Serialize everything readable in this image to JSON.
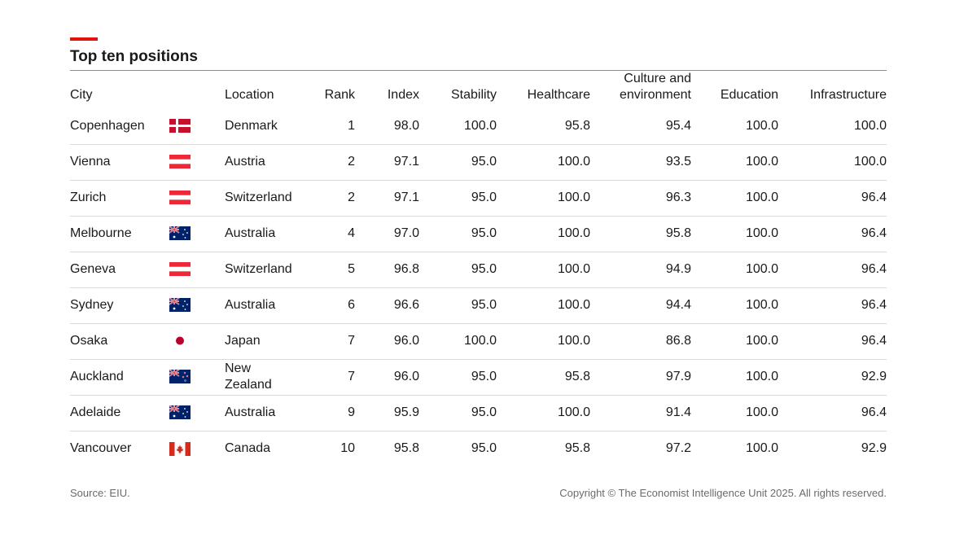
{
  "title": "Top ten positions",
  "colors": {
    "accent": "#e3120b",
    "rule": "#d9d9d9"
  },
  "chart_data": {
    "type": "table",
    "title": "Top ten positions",
    "columns": [
      "City",
      "",
      "Location",
      "Rank",
      "Index",
      "Stability",
      "Healthcare",
      "Culture and environment",
      "Education",
      "Infrastructure"
    ],
    "rows": [
      {
        "city": "Copenhagen",
        "flag": "denmark-flag-icon",
        "location": "Denmark",
        "rank": "1",
        "index": "98.0",
        "stability": "100.0",
        "healthcare": "95.8",
        "culture": "95.4",
        "education": "100.0",
        "infrastructure": "100.0"
      },
      {
        "city": "Vienna",
        "flag": "austria-flag-icon",
        "location": "Austria",
        "rank": "2",
        "index": "97.1",
        "stability": "95.0",
        "healthcare": "100.0",
        "culture": "93.5",
        "education": "100.0",
        "infrastructure": "100.0"
      },
      {
        "city": "Zurich",
        "flag": "switzerland-flag-icon",
        "location": "Switzerland",
        "rank": "2",
        "index": "97.1",
        "stability": "95.0",
        "healthcare": "100.0",
        "culture": "96.3",
        "education": "100.0",
        "infrastructure": "96.4"
      },
      {
        "city": "Melbourne",
        "flag": "australia-flag-icon",
        "location": "Australia",
        "rank": "4",
        "index": "97.0",
        "stability": "95.0",
        "healthcare": "100.0",
        "culture": "95.8",
        "education": "100.0",
        "infrastructure": "96.4"
      },
      {
        "city": "Geneva",
        "flag": "switzerland-flag-icon",
        "location": "Switzerland",
        "rank": "5",
        "index": "96.8",
        "stability": "95.0",
        "healthcare": "100.0",
        "culture": "94.9",
        "education": "100.0",
        "infrastructure": "96.4"
      },
      {
        "city": "Sydney",
        "flag": "australia-flag-icon",
        "location": "Australia",
        "rank": "6",
        "index": "96.6",
        "stability": "95.0",
        "healthcare": "100.0",
        "culture": "94.4",
        "education": "100.0",
        "infrastructure": "96.4"
      },
      {
        "city": "Osaka",
        "flag": "japan-flag-icon",
        "location": "Japan",
        "rank": "7",
        "index": "96.0",
        "stability": "100.0",
        "healthcare": "100.0",
        "culture": "86.8",
        "education": "100.0",
        "infrastructure": "96.4"
      },
      {
        "city": "Auckland",
        "flag": "new-zealand-flag-icon",
        "location": "New Zealand",
        "rank": "7",
        "index": "96.0",
        "stability": "95.0",
        "healthcare": "95.8",
        "culture": "97.9",
        "education": "100.0",
        "infrastructure": "92.9"
      },
      {
        "city": "Adelaide",
        "flag": "australia-flag-icon",
        "location": "Australia",
        "rank": "9",
        "index": "95.9",
        "stability": "95.0",
        "healthcare": "100.0",
        "culture": "91.4",
        "education": "100.0",
        "infrastructure": "96.4"
      },
      {
        "city": "Vancouver",
        "flag": "canada-flag-icon",
        "location": "Canada",
        "rank": "10",
        "index": "95.8",
        "stability": "95.0",
        "healthcare": "95.8",
        "culture": "97.2",
        "education": "100.0",
        "infrastructure": "92.9"
      }
    ]
  },
  "footer": {
    "source": "Source: EIU.",
    "copyright": "Copyright © The Economist Intelligence Unit 2025. All rights reserved."
  }
}
